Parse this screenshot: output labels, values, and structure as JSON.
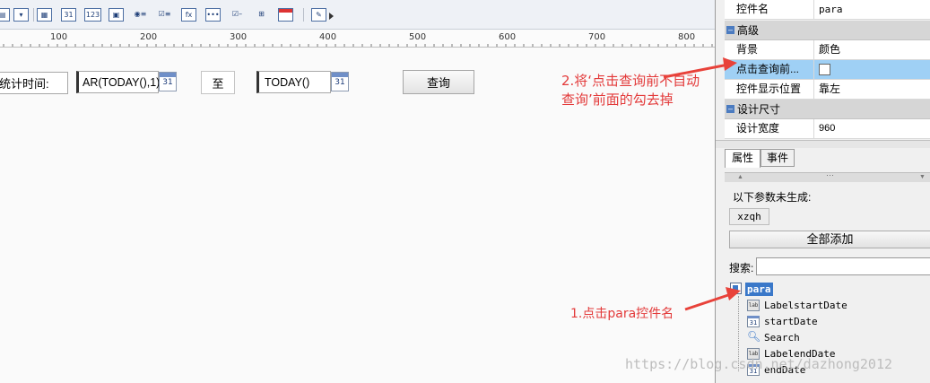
{
  "form": {
    "stat_time_label": "统计时间:",
    "start_value": "AR(TODAY(),1)",
    "to_label": "至",
    "end_value": "TODAY()",
    "query_button": "查询",
    "calendar_number": "31"
  },
  "ruler": {
    "labels": [
      "100",
      "200",
      "300",
      "400",
      "500",
      "600",
      "700",
      "800"
    ]
  },
  "toolbar": {
    "icons": [
      "list-box-icon",
      "combo-box-icon",
      "form-panel-icon",
      "date-field-icon",
      "number-field-icon",
      "radio-group-icon",
      "checkbox-group-icon",
      "formula-icon",
      "more-icon",
      "checkbox-icon",
      "tree-icon",
      "date-calendar-icon",
      "edit-icon"
    ],
    "glyph_31": "31",
    "glyph_123": "123",
    "glyph_fx": "fx",
    "glyph_more": "•••"
  },
  "properties": {
    "rows_top": [
      {
        "key": "控件名",
        "value": "para"
      }
    ],
    "group_advanced": "高级",
    "rows_advanced": [
      {
        "key": "背景",
        "value": "颜色"
      },
      {
        "key": "点击查询前...",
        "value": ""
      },
      {
        "key": "控件显示位置",
        "value": "靠左"
      }
    ],
    "group_design": "设计尺寸",
    "rows_design": [
      {
        "key": "设计宽度",
        "value": "960"
      }
    ]
  },
  "tabs": {
    "attributes": "属性",
    "events": "事件"
  },
  "params": {
    "not_generated": "以下参数未生成:",
    "chip": "xzqh",
    "add_all": "全部添加",
    "search_label": "搜索:",
    "search_value": ""
  },
  "tree": {
    "root": "para",
    "children": [
      {
        "name": "LabelstartDate",
        "icon": "lab"
      },
      {
        "name": "startDate",
        "icon": "31"
      },
      {
        "name": "Search",
        "icon": "search"
      },
      {
        "name": "LabelendDate",
        "icon": "lab"
      },
      {
        "name": "endDate",
        "icon": "31"
      }
    ]
  },
  "annotations": {
    "note1": "1.点击para控件名",
    "note2_line1": "2.将‘点击查询前不自动",
    "note2_line2": "查询’前面的勾去掉",
    "arrow_color": "#e8423a"
  },
  "watermark": "https://blog.csdn.net/dazhong2012",
  "colors": {
    "highlight_row": "#9fd0f5",
    "tree_selected": "#3a78c9",
    "note_red": "#e33a3a"
  }
}
